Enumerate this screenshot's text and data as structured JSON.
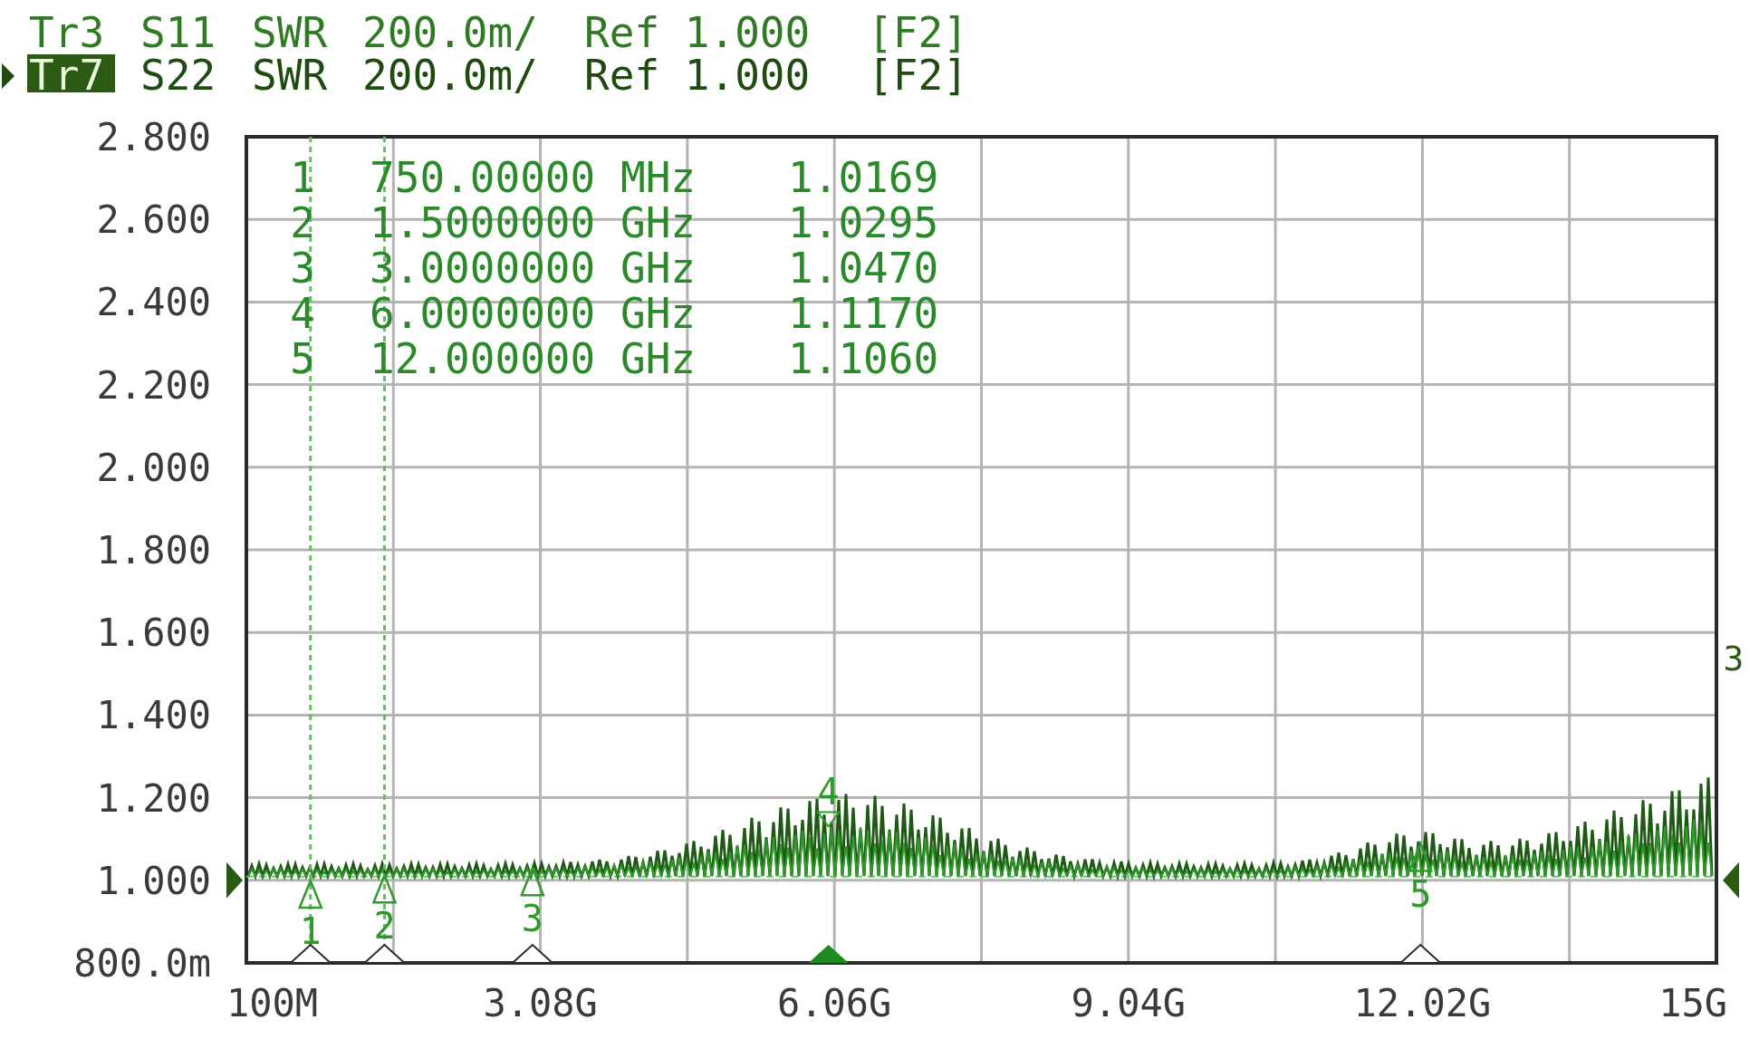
{
  "traces": [
    {
      "label": "Tr3",
      "param": "S11",
      "format": "SWR",
      "scale": "200.0m/",
      "ref": "Ref 1.000",
      "channel": "[F2]",
      "selected": false
    },
    {
      "label": "Tr7",
      "param": "S22",
      "format": "SWR",
      "scale": "200.0m/",
      "ref": "Ref 1.000",
      "channel": "[F2]",
      "selected": true
    }
  ],
  "chart": {
    "y_labels": [
      "2.800",
      "2.600",
      "2.400",
      "2.200",
      "2.000",
      "1.800",
      "1.600",
      "1.400",
      "1.200",
      "1.000",
      "800.0m"
    ],
    "x_labels": [
      "100M",
      "3.08G",
      "6.06G",
      "9.04G",
      "12.02G",
      "15G"
    ],
    "edge_label": "3"
  },
  "markers": [
    {
      "number": "1",
      "stimulus": "750.00000 MHz",
      "value": "1.0169",
      "plot_label": "1",
      "selected": false,
      "line": true
    },
    {
      "number": "2",
      "stimulus": "1.5000000 GHz",
      "value": "1.0295",
      "plot_label": "2",
      "selected": false,
      "line": true
    },
    {
      "number": "3",
      "stimulus": "3.0000000 GHz",
      "value": "1.0470",
      "plot_label": "3",
      "selected": false,
      "line": false
    },
    {
      "number": "4",
      "stimulus": "6.0000000 GHz",
      "value": "1.1170",
      "plot_label": "4",
      "selected": true,
      "line": false
    },
    {
      "number": "5",
      "stimulus": "12.000000 GHz",
      "value": "1.1060",
      "plot_label": "5",
      "selected": false,
      "line": false
    }
  ]
}
